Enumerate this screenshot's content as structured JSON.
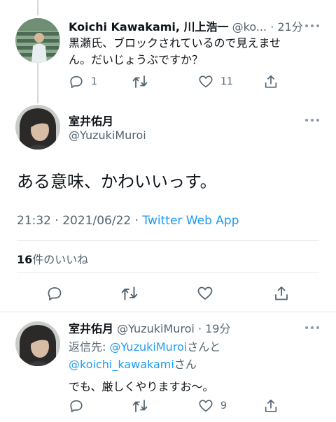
{
  "top_reply": {
    "display_name": "Koichi Kawakami, 川上浩一",
    "handle": "@ko...",
    "dot": "·",
    "time": "21分",
    "text_line1": "黒瀬氏、ブロックされているので見えませ",
    "text_line2": "ん。だいじょうぶですか？",
    "reply_count": "1",
    "retweet_count": "",
    "like_count": "11"
  },
  "main_tweet": {
    "display_name": "室井佑月",
    "handle": "@YuzukiMuroi",
    "text": "ある意味、かわいいっす。",
    "time": "21:32",
    "dot": "·",
    "date": "2021/06/22",
    "source": "Twitter Web App",
    "likes_number": "16",
    "likes_label": "件のいいね"
  },
  "bottom_reply": {
    "display_name": "室井佑月",
    "handle": "@YuzukiMuroi",
    "dot": "·",
    "time": "19分",
    "replying_prefix": "返信先: ",
    "replying_user1": "@YuzukiMuroi",
    "replying_and": "さんと",
    "replying_user2": "@koichi_kawakami",
    "replying_suffix": "さん",
    "text": "でも、厳しくやりますお〜。",
    "reply_count": "",
    "retweet_count": "",
    "like_count": "9"
  },
  "colors": {
    "text": "#0f1419",
    "secondary": "#536471",
    "link": "#1d9bf0",
    "divider": "#e6e8eb"
  },
  "icons": [
    "reply-icon",
    "retweet-icon",
    "like-icon",
    "share-icon",
    "more-icon"
  ]
}
